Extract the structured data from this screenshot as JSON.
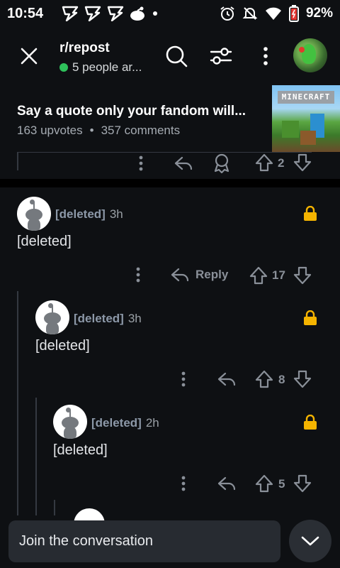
{
  "status_bar": {
    "time": "10:54",
    "battery_percent": "92%",
    "icons": [
      "bolt-notification-icon",
      "bolt-notification-icon",
      "bolt-notification-icon",
      "reddit-notification-icon",
      "dot-icon",
      "alarm-icon",
      "mute-icon",
      "wifi-icon",
      "battery-icon"
    ]
  },
  "header": {
    "subreddit": "r/repost",
    "online_text": "5 people ar...",
    "icons": [
      "close-icon",
      "search-icon",
      "filter-icon",
      "more-vertical-icon",
      "avatar"
    ]
  },
  "post": {
    "title": "Say a quote only your fandom will...",
    "upvotes": "163 upvotes",
    "separator": "•",
    "comments": "357 comments",
    "thumbnail_text": "MINECRAFT"
  },
  "previous_comment_actions": {
    "vote_count": "2"
  },
  "comments": [
    {
      "user": "[deleted]",
      "age": "3h",
      "body": "[deleted]",
      "reply_label": "Reply",
      "vote_count": "17"
    },
    {
      "user": "[deleted]",
      "age": "3h",
      "body": "[deleted]",
      "vote_count": "8"
    },
    {
      "user": "[deleted]",
      "age": "2h",
      "body": "[deleted]",
      "vote_count": "5"
    }
  ],
  "composer": {
    "placeholder": "Join the conversation"
  },
  "colors": {
    "background": "#0e1013",
    "lock": "#f5b400",
    "online": "#2ec15b",
    "muted_text": "#8a9099"
  }
}
